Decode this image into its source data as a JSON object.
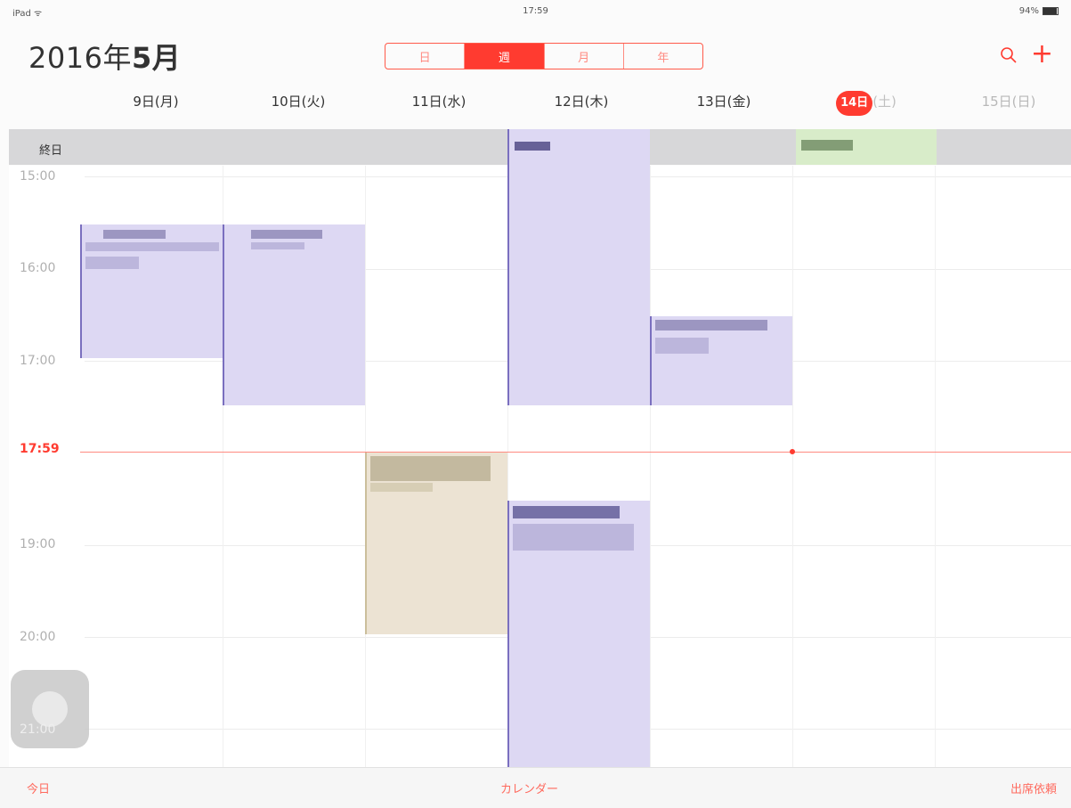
{
  "status": {
    "device": "iPad ᯤ",
    "time": "17:59",
    "battery": "94%"
  },
  "header": {
    "year": "2016年",
    "month": "5月"
  },
  "view_switcher": {
    "items": [
      "日",
      "週",
      "月",
      "年"
    ],
    "active_index": 1
  },
  "icons": {
    "search": "search-icon",
    "add": "+"
  },
  "days": [
    {
      "label": "9日(月)"
    },
    {
      "label": "10日(火)"
    },
    {
      "label": "11日(水)"
    },
    {
      "label": "12日(木)"
    },
    {
      "label": "13日(金)"
    },
    {
      "date": "14日",
      "weekday": "(土)"
    },
    {
      "label": "15日(日)"
    }
  ],
  "allday": {
    "label": "終日"
  },
  "hours": [
    "15:00",
    "16:00",
    "17:00",
    "19:00",
    "20:00",
    "21:00"
  ],
  "now": {
    "label": "17:59"
  },
  "toolbar": {
    "today": "今日",
    "calendars": "カレンダー",
    "inbox": "出席依頼"
  },
  "colors": {
    "accent": "#ff3b30",
    "event_purple": "#ddd8f3",
    "event_beige": "#ece3d3",
    "event_green": "#d8ecc9"
  }
}
